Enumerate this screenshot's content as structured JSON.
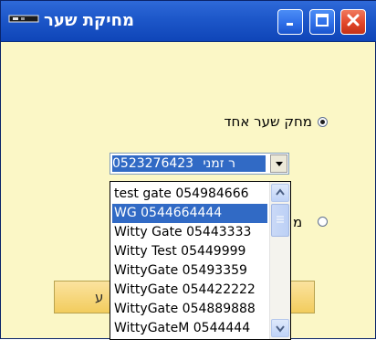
{
  "window": {
    "title": "מחיקת שער",
    "controls": [
      "minimize",
      "maximize",
      "close"
    ],
    "colors": {
      "titlebar": "#1d57c9",
      "client_bg": "#fbf7c6",
      "selection": "#316ac5"
    }
  },
  "form": {
    "radio_delete_one": {
      "label": "מחק שער אחד",
      "checked": true
    },
    "radio_second": {
      "label_partial": "מ",
      "checked": false
    },
    "combo": {
      "selected_text": "0523276423 ר זמני",
      "text_head": "0523276423",
      "text_tail": "ר זמני"
    },
    "action_button": {
      "label_partial": "ע"
    }
  },
  "dropdown": {
    "items": [
      "test gate  054984666",
      "WG  0544664444",
      "Witty Gate  05443333",
      "Witty Test  05449999",
      "WittyGate  05493359",
      "WittyGate  054422222",
      "WittyGate  054889888",
      "WittyGateM  0544444"
    ],
    "selected_index": 1
  }
}
